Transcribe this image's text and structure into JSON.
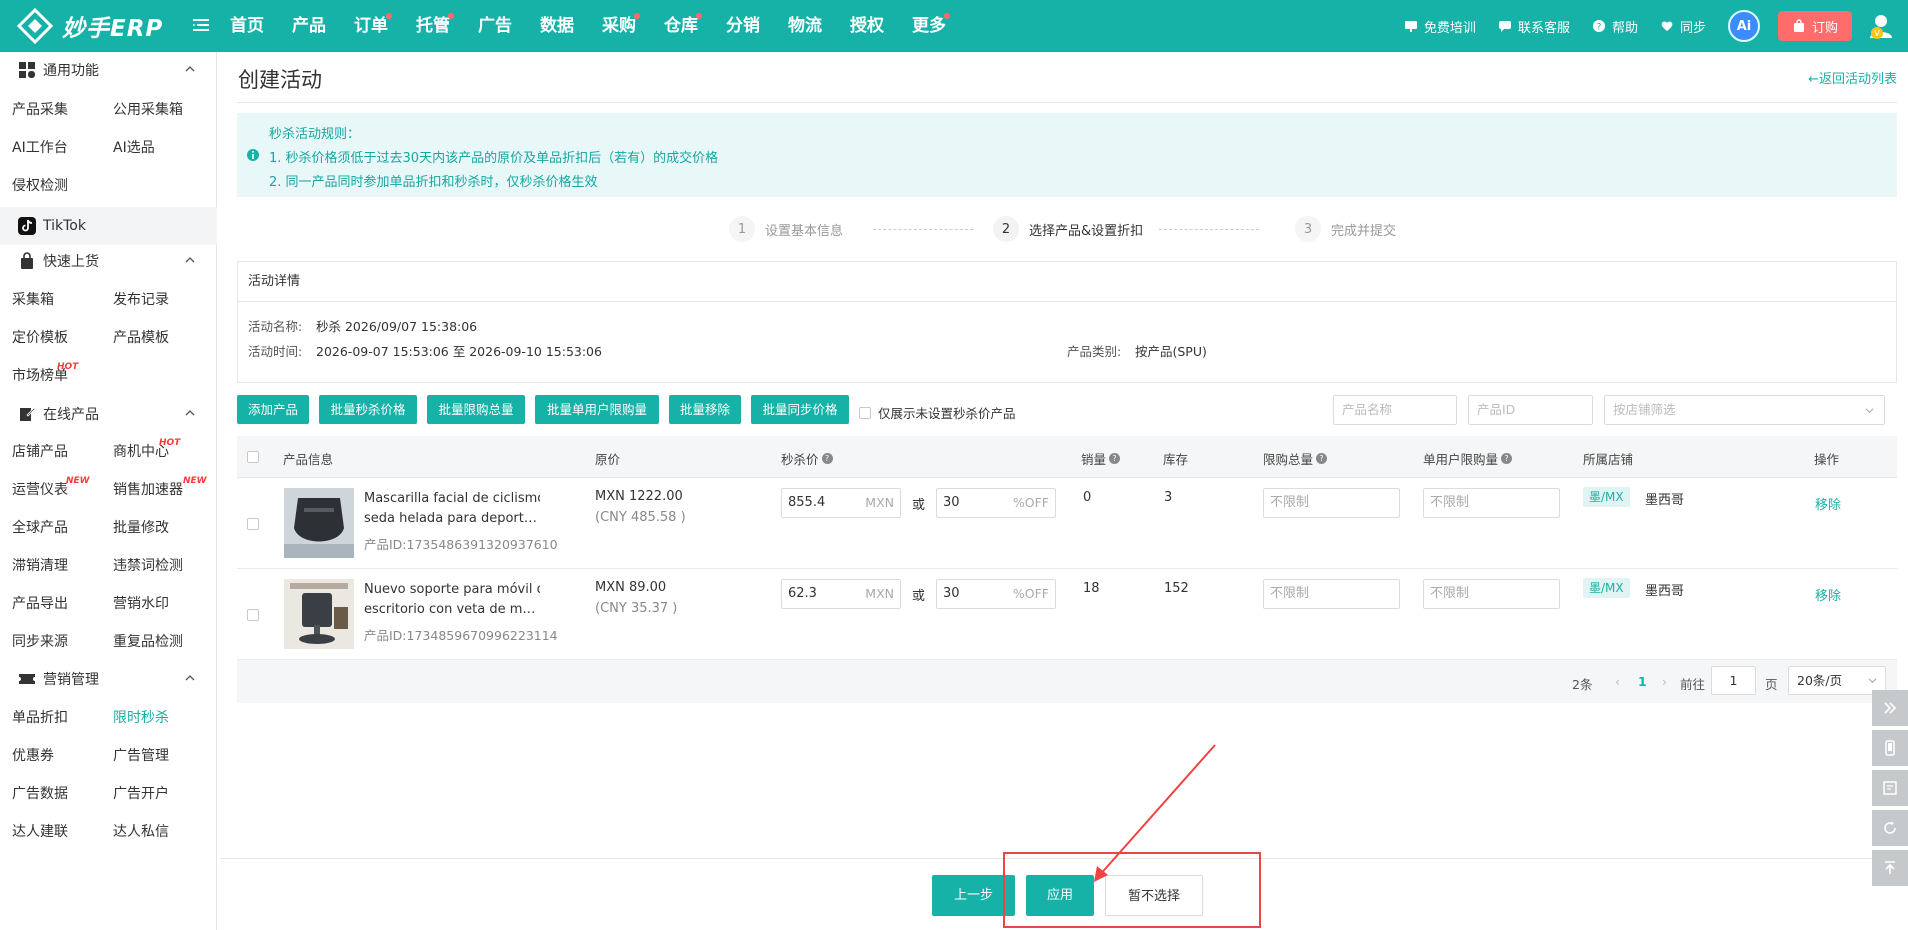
{
  "app": {
    "logo_text": "妙手ERP"
  },
  "nav": [
    {
      "label": "首页",
      "dot": false
    },
    {
      "label": "产品",
      "dot": false
    },
    {
      "label": "订单",
      "dot": true
    },
    {
      "label": "托管",
      "dot": true
    },
    {
      "label": "广告",
      "dot": false
    },
    {
      "label": "数据",
      "dot": false
    },
    {
      "label": "采购",
      "dot": true
    },
    {
      "label": "仓库",
      "dot": true
    },
    {
      "label": "分销",
      "dot": false
    },
    {
      "label": "物流",
      "dot": false
    },
    {
      "label": "授权",
      "dot": false
    },
    {
      "label": "更多",
      "dot": true
    }
  ],
  "top_right": {
    "training": "免费培训",
    "support": "联系客服",
    "help": "帮助",
    "sync": "同步",
    "ai": "Ai",
    "order": "订购"
  },
  "sidebar": {
    "general": {
      "title": "通用功能",
      "items": [
        "产品采集",
        "公用采集箱",
        "AI工作台",
        "AI选品",
        "侵权检测"
      ]
    },
    "platform": "TikTok",
    "quick_listing": {
      "title": "快速上货",
      "items": [
        "采集箱",
        "发布记录",
        "定价模板",
        "产品模板",
        "市场榜单"
      ],
      "hot_label": "HOT"
    },
    "online": {
      "title": "在线产品",
      "items": [
        "店铺产品",
        "商机中心",
        "运营仪表",
        "销售加速器",
        "全球产品",
        "批量修改",
        "滞销清理",
        "违禁词检测",
        "产品导出",
        "营销水印",
        "同步来源",
        "重复品检测"
      ],
      "hot_label": "HOT",
      "new_label": "NEW"
    },
    "marketing": {
      "title": "营销管理",
      "items": [
        "单品折扣",
        "限时秒杀",
        "优惠券",
        "广告管理",
        "广告数据",
        "广告开户",
        "达人建联",
        "达人私信"
      ]
    }
  },
  "page": {
    "title": "创建活动",
    "back": "←返回活动列表",
    "notice": {
      "title": "秒杀活动规则：",
      "rule1": "1. 秒杀价格须低于过去30天内该产品的原价及单品折扣后（若有）的成交价格",
      "rule2": "2. 同一产品同时参加单品折扣和秒杀时，仅秒杀价格生效"
    },
    "steps": [
      {
        "num": "1",
        "label": "设置基本信息"
      },
      {
        "num": "2",
        "label": "选择产品&设置折扣"
      },
      {
        "num": "3",
        "label": "完成并提交"
      }
    ],
    "detail": {
      "header": "活动详情",
      "name_label": "活动名称:",
      "name_value": "秒杀 2026/09/07 15:38:06",
      "time_label": "活动时间:",
      "time_value": "2026-09-07 15:53:06 至 2026-09-10 15:53:06",
      "type_label": "产品类别:",
      "type_value": "按产品(SPU)"
    },
    "toolbar": {
      "add": "添加产品",
      "batch_price": "批量秒杀价格",
      "batch_total": "批量限购总量",
      "batch_user": "批量单用户限购量",
      "batch_remove": "批量移除",
      "batch_sync": "批量同步价格",
      "only_unset": "仅展示未设置秒杀价产品",
      "name_ph": "产品名称",
      "id_ph": "产品ID",
      "store_ph": "按店铺筛选"
    },
    "table": {
      "headers": {
        "info": "产品信息",
        "price": "原价",
        "flash": "秒杀价",
        "sales": "销量",
        "stock": "库存",
        "limit_total": "限购总量",
        "limit_user": "单用户限购量",
        "store": "所属店铺",
        "action": "操作"
      },
      "rows": [
        {
          "name1": "Mascarilla facial de ciclismo de",
          "name2": "seda helada para deportes al ai...",
          "id": "产品ID:1735486391320937610",
          "price": "MXN 1222.00",
          "price_cny": "(CNY 485.58 )",
          "flash": "855.4",
          "currency": "MXN",
          "or": "或",
          "discount": "30",
          "off": "%OFF",
          "sales": "0",
          "stock": "3",
          "limit_ph": "不限制",
          "store_tag": "墨/MX",
          "store_name": "墨西哥",
          "action": "移除"
        },
        {
          "name1": "Nuevo soporte para móvil de",
          "name2": "escritorio con veta de madera, ...",
          "id": "产品ID:1734859670996223114",
          "price": "MXN 89.00",
          "price_cny": "(CNY 35.37 )",
          "flash": "62.3",
          "currency": "MXN",
          "or": "或",
          "discount": "30",
          "off": "%OFF",
          "sales": "18",
          "stock": "152",
          "limit_ph": "不限制",
          "store_tag": "墨/MX",
          "store_name": "墨西哥",
          "action": "移除"
        }
      ]
    },
    "pager": {
      "total": "2条",
      "prev": "‹",
      "page": "1",
      "next": "›",
      "goto": "前往",
      "goto_value": "1",
      "page_unit": "页",
      "size": "20条/页"
    },
    "footer": {
      "prev": "上一步",
      "apply": "应用",
      "skip": "暂不选择"
    }
  },
  "colors": {
    "brand": "#17b2a7",
    "order": "#ff6c6c",
    "highlight": "#ee4444"
  }
}
